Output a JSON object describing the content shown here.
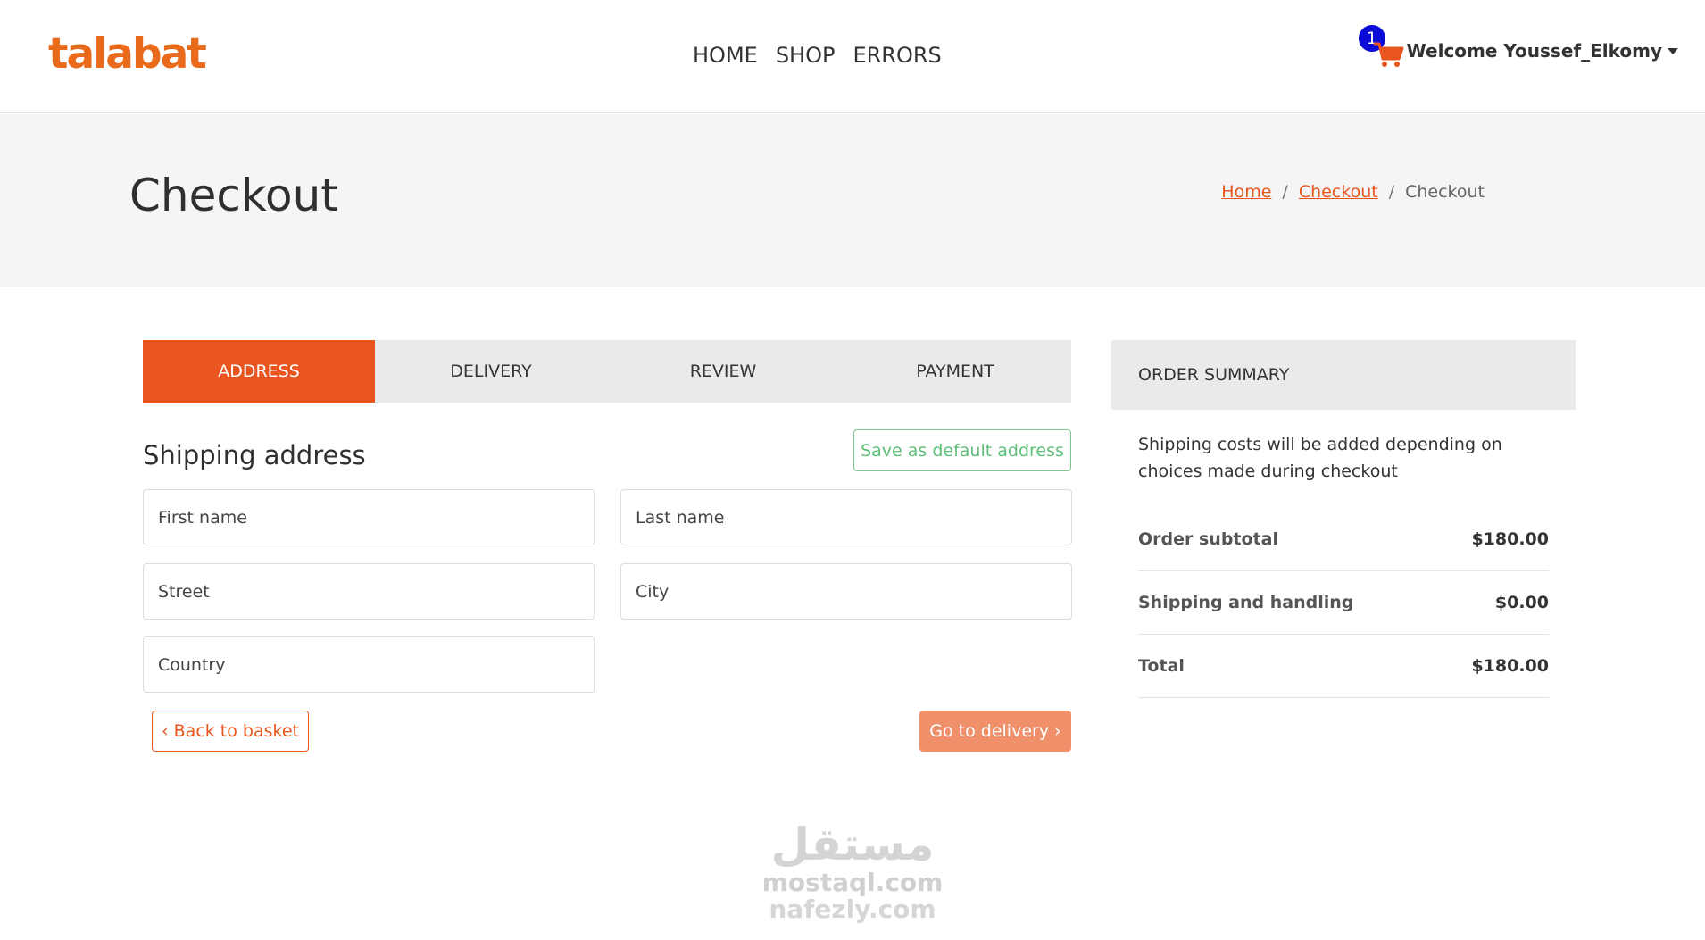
{
  "brand": {
    "name": "talabat",
    "color": "#ea6a1b"
  },
  "nav": {
    "items": [
      "HOME",
      "SHOP",
      "ERRORS"
    ]
  },
  "user": {
    "cart_count": "1",
    "welcome": "Welcome Youssef_Elkomy",
    "cart_icon": "shopping-cart-icon"
  },
  "page": {
    "title": "Checkout",
    "breadcrumb": {
      "home": "Home",
      "parent": "Checkout",
      "current": "Checkout",
      "separator": "/"
    }
  },
  "steps": {
    "items": [
      "ADDRESS",
      "DELIVERY",
      "REVIEW",
      "PAYMENT"
    ],
    "active": "ADDRESS"
  },
  "form": {
    "title": "Shipping address",
    "save_default": "Save as default address",
    "fields": {
      "first_name": "First name",
      "last_name": "Last name",
      "street": "Street",
      "city": "City",
      "country": "Country"
    },
    "back": "‹ Back to basket",
    "next": "Go to delivery ›"
  },
  "summary": {
    "title": "ORDER SUMMARY",
    "note": "Shipping costs will be added depending on choices made during checkout",
    "rows": [
      {
        "label": "Order subtotal",
        "value": "$180.00"
      },
      {
        "label": "Shipping and handling",
        "value": "$0.00"
      },
      {
        "label": "Total",
        "value": "$180.00"
      }
    ]
  },
  "watermark": {
    "logo": "مستقل",
    "line1": "mostaql.com",
    "line2": "nafezly.com"
  },
  "colors": {
    "accent": "#e8551f",
    "accent_light": "#f0906a",
    "success": "#5fbf78",
    "badge": "#0b0bd8",
    "band": "#f5f5f5"
  }
}
